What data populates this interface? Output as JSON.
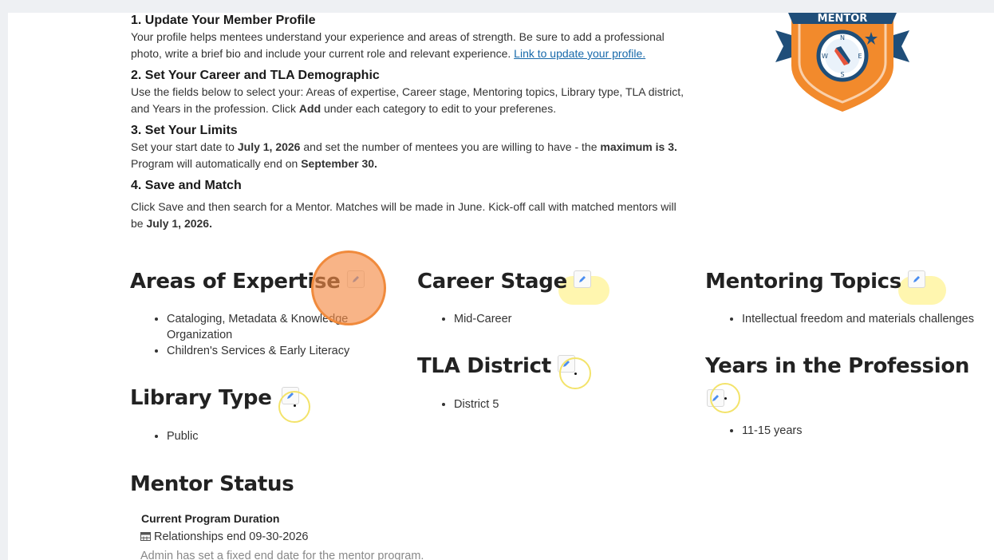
{
  "steps": [
    {
      "title": "1. Update Your Member Profile",
      "text": "Your profile helps mentees understand your experience and areas of strength. Be sure to add a professional photo, write a brief bio and include your current role and relevant experience. ",
      "link": "Link to update your profile."
    },
    {
      "title": "2. Set Your Career and TLA Demographic",
      "text_a": "Use the fields below to select your: Areas of expertise, Career stage, Mentoring topics, Library type, TLA district, and Years in the profession. Click ",
      "bold": "Add",
      "text_b": " under each category to edit to your preferenes."
    },
    {
      "title": "3. Set Your Limits",
      "text_a": "Set your start date to ",
      "bold_a": "July 1, 2026",
      "text_b": " and set the number of mentees you are willing to have - the ",
      "bold_b": "maximum is 3.",
      "text_c": " Program will automatically end on ",
      "bold_c": "September 30."
    },
    {
      "title": "4. Save and Match",
      "text_a": "Click Save and then search for a Mentor. Matches will be made in June. Kick-off call with matched mentors will be ",
      "bold_a": "July 1, 2026."
    }
  ],
  "sections": {
    "areas_of_expertise": {
      "title": "Areas of Expertise",
      "items": [
        "Cataloging, Metadata & Knowledge Organization",
        "Children's Services & Early Literacy"
      ]
    },
    "career_stage": {
      "title": "Career Stage",
      "items": [
        "Mid-Career"
      ]
    },
    "mentoring_topics": {
      "title": "Mentoring Topics",
      "items": [
        "Intellectual freedom and materials challenges"
      ]
    },
    "tla_district": {
      "title": "TLA District",
      "items": [
        "District 5"
      ]
    },
    "years_in_profession": {
      "title": "Years in the Profession",
      "items": [
        "11-15 years"
      ]
    },
    "library_type": {
      "title": "Library Type",
      "items": [
        "Public"
      ]
    }
  },
  "mentor_status": {
    "title": "Mentor Status",
    "duration_label": "Current Program Duration",
    "relationships_end": "Relationships end 09-30-2026",
    "note": "Admin has set a fixed end date for the mentor program."
  },
  "badge": {
    "text": "MENTOR",
    "compass_letters": [
      "N",
      "E",
      "S",
      "W"
    ]
  },
  "icons": {
    "edit": "pencil-icon",
    "calendar": "calendar-icon"
  },
  "colors": {
    "badge_orange": "#f28a2c",
    "badge_navy": "#1f4e79",
    "link": "#1769aa"
  }
}
